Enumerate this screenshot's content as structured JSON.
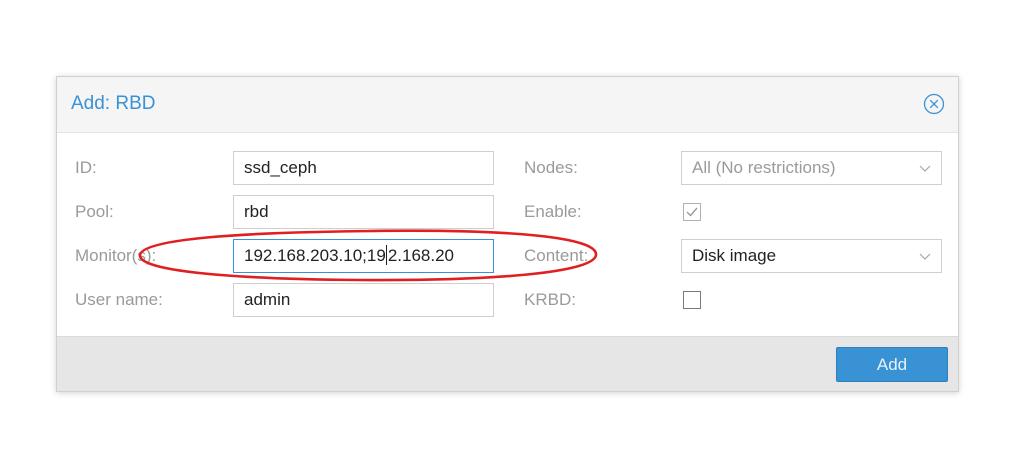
{
  "dialog": {
    "title": "Add: RBD",
    "close_icon": "close-circle-icon"
  },
  "form": {
    "left": [
      {
        "label": "ID:",
        "value": "ssd_ceph"
      },
      {
        "label": "Pool:",
        "value": "rbd"
      },
      {
        "label": "Monitor(s):",
        "value_before_caret": "192.168.203.10;19",
        "value_after_caret": "2.168.20"
      },
      {
        "label": "User name:",
        "value": "admin"
      }
    ],
    "right": {
      "nodes": {
        "label": "Nodes:",
        "value": "All (No restrictions)"
      },
      "enable": {
        "label": "Enable:",
        "checked": true
      },
      "content": {
        "label": "Content:",
        "value": "Disk image"
      },
      "krbd": {
        "label": "KRBD:",
        "checked": false
      }
    }
  },
  "footer": {
    "add_label": "Add"
  },
  "colors": {
    "accent": "#3892d4",
    "annotation": "#e02020",
    "label": "#9a9a9a"
  }
}
